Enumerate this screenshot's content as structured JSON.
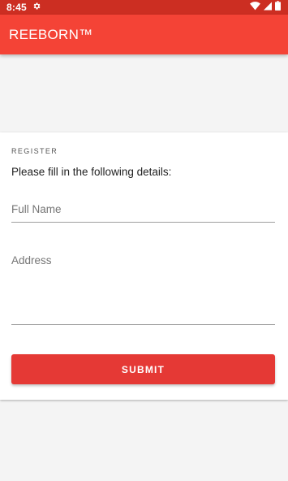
{
  "status_bar": {
    "time": "8:45",
    "icons": [
      "settings-icon",
      "wifi-icon",
      "signal-icon",
      "battery-icon"
    ]
  },
  "app_bar": {
    "title": "REEBORN™"
  },
  "form": {
    "overline": "REGISTER",
    "instructions": "Please fill in the following details:",
    "full_name_placeholder": "Full Name",
    "address_placeholder": "Address",
    "submit_label": "SUBMIT"
  },
  "colors": {
    "primary": "#f44336",
    "primary_dark": "#cc2e22",
    "button": "#e53935"
  }
}
